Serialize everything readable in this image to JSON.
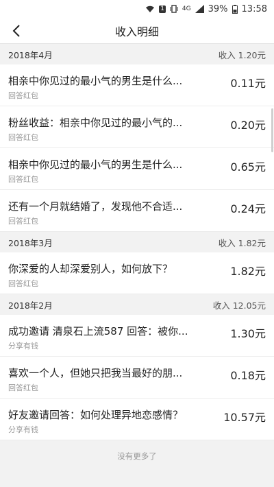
{
  "status_bar": {
    "alert_label": "1",
    "network_label": "4G",
    "battery": "39%",
    "time": "13:58"
  },
  "nav": {
    "title": "收入明细"
  },
  "months": [
    {
      "label": "2018年4月",
      "total": "收入 1.20元",
      "entries": [
        {
          "title": "相亲中你见过的最小气的男生是什么...",
          "sub": "回答红包",
          "amount": "0.11元"
        },
        {
          "title": "粉丝收益：相亲中你见过的最小气的...",
          "sub": "回答红包",
          "amount": "0.20元"
        },
        {
          "title": "相亲中你见过的最小气的男生是什么...",
          "sub": "回答红包",
          "amount": "0.65元"
        },
        {
          "title": "还有一个月就结婚了，发现他不合适...",
          "sub": "回答红包",
          "amount": "0.24元"
        }
      ]
    },
    {
      "label": "2018年3月",
      "total": "收入 1.82元",
      "entries": [
        {
          "title": "你深爱的人却深爱别人，如何放下？",
          "sub": "回答红包",
          "amount": "1.82元"
        }
      ]
    },
    {
      "label": "2018年2月",
      "total": "收入 12.05元",
      "entries": [
        {
          "title": "成功邀请 清泉石上流587 回答：被你...",
          "sub": "分享有钱",
          "amount": "1.30元"
        },
        {
          "title": "喜欢一个人，但她只把我当最好的朋...",
          "sub": "回答红包",
          "amount": "0.18元"
        },
        {
          "title": "好友邀请回答：如何处理异地恋感情？",
          "sub": "分享有钱",
          "amount": "10.57元"
        }
      ]
    }
  ],
  "footer": {
    "text": "没有更多了"
  }
}
